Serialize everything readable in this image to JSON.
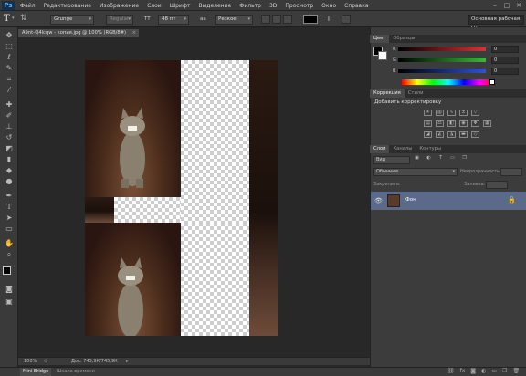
{
  "app": {
    "logo": "Ps",
    "menus": [
      "Файл",
      "Редактирование",
      "Изображение",
      "Слои",
      "Шрифт",
      "Выделение",
      "Фильтр",
      "3D",
      "Просмотр",
      "Окно",
      "Справка"
    ],
    "window_controls": [
      "–",
      "□",
      "✕"
    ]
  },
  "options": {
    "font_family": "Grunge",
    "font_style": "Regular",
    "size_icon": "TT",
    "font_size": "48 пт",
    "aa_icon": "aa",
    "antialias": "Резкое",
    "workspace": "Основная рабочая ср"
  },
  "tools": [
    "move",
    "marquee",
    "lasso",
    "quick-select",
    "crop",
    "eyedropper",
    "healing",
    "brush",
    "stamp",
    "history-brush",
    "eraser",
    "gradient",
    "blur",
    "dodge",
    "pen",
    "type",
    "path-select",
    "shape",
    "hand",
    "zoom"
  ],
  "document": {
    "tab_title": "A9nt-Q4lcqw - копия.jpg @ 100% (RGB/8#)",
    "zoom": "100%",
    "doc_size": "Док: 745,9К/745,9К"
  },
  "color_panel": {
    "tabs": [
      "Цвет",
      "Образцы"
    ],
    "channels": [
      {
        "label": "R",
        "value": "0",
        "color": "#e03030"
      },
      {
        "label": "G",
        "value": "0",
        "color": "#30c030"
      },
      {
        "label": "B",
        "value": "0",
        "color": "#3050e0"
      }
    ]
  },
  "adjust_panel": {
    "tabs": [
      "Коррекция",
      "Стили"
    ],
    "heading": "Добавить корректировку"
  },
  "layers_panel": {
    "tabs": [
      "Слои",
      "Каналы",
      "Контуры"
    ],
    "kind": "Вид",
    "blend_mode": "Обычные",
    "opacity_label": "Непрозрачность:",
    "fill_label": "Заливка:",
    "lock_label": "Закрепить:",
    "layer": {
      "name": "Фон",
      "visible": true
    }
  },
  "bottom": {
    "tabs": [
      "Mini Bridge",
      "Шкала времени"
    ]
  }
}
